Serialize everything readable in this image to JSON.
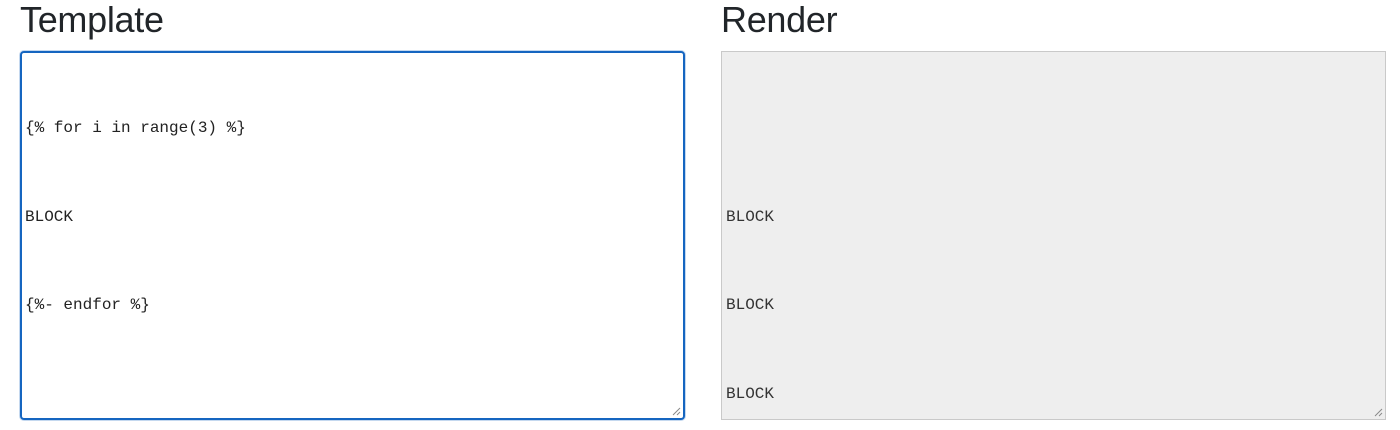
{
  "template_panel": {
    "heading": "Template",
    "lines": [
      "{% for i in range(3) %}",
      "BLOCK",
      "{%- endfor %}"
    ]
  },
  "render_panel": {
    "heading": "Render",
    "lines": [
      "",
      "BLOCK",
      "BLOCK",
      "BLOCK"
    ]
  },
  "icons": {
    "resize": "resize-grip-icon"
  },
  "colors": {
    "editor_border": "#1565c0",
    "output_background": "#eeeeee",
    "heading_text": "#212529"
  }
}
